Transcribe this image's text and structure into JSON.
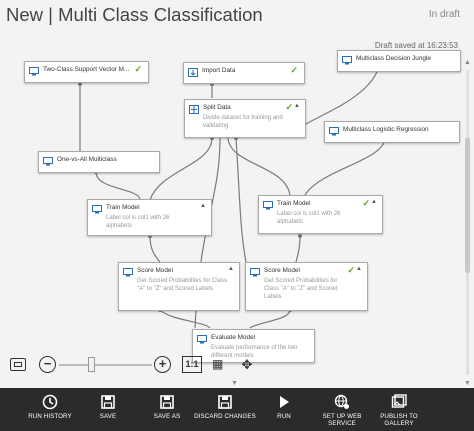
{
  "header": {
    "title": "New | Multi Class Classification",
    "status": "In draft",
    "saved_text": "Draft saved at 16:23:53"
  },
  "modules": {
    "svm": {
      "title": "Two-Class Support Vector M...",
      "check": "✓"
    },
    "import": {
      "title": "Import Data",
      "check": "✓"
    },
    "jungle": {
      "title": "Multiclass Decision Jungle"
    },
    "split": {
      "title": "Split Data",
      "desc": "Divide dataset for training and validating",
      "check": "✓"
    },
    "logistic": {
      "title": "Multiclass Logistic Regression"
    },
    "ova": {
      "title": "One-vs-All Multiclass"
    },
    "train1": {
      "title": "Train Model",
      "desc": "Label col is col1 with 26 alphabets"
    },
    "train2": {
      "title": "Train Model",
      "desc": "Label col is col1 with 26 alphabets",
      "check": "✓"
    },
    "score1": {
      "title": "Score Model",
      "desc": "Get Scored Probabilities for Class \"A\" to \"Z\" and Scored Labels"
    },
    "score2": {
      "title": "Score Model",
      "desc": "Get Scored Probabilities for Class \"A\" to \"Z\" and Scored Labels",
      "check": "✓"
    },
    "evaluate": {
      "title": "Evaluate Model",
      "desc": "Evaluate performance of the two different models"
    }
  },
  "zoom": {
    "one_to_one": "1:1",
    "level": 0.34
  },
  "toolbar": {
    "items": [
      {
        "label": "RUN HISTORY",
        "icon": "clock-icon"
      },
      {
        "label": "SAVE",
        "icon": "save-icon"
      },
      {
        "label": "SAVE AS",
        "icon": "save-as-icon"
      },
      {
        "label": "DISCARD CHANGES",
        "icon": "discard-icon"
      },
      {
        "label": "RUN",
        "icon": "run-icon"
      },
      {
        "label": "SET UP WEB SERVICE",
        "icon": "globe-gear-icon"
      },
      {
        "label": "PUBLISH TO GALLERY",
        "icon": "gallery-icon"
      }
    ]
  },
  "colors": {
    "toolbar_bg": "#2b2b2b",
    "check_green": "#5aa32a",
    "icon_blue": "#2a6ebb"
  }
}
